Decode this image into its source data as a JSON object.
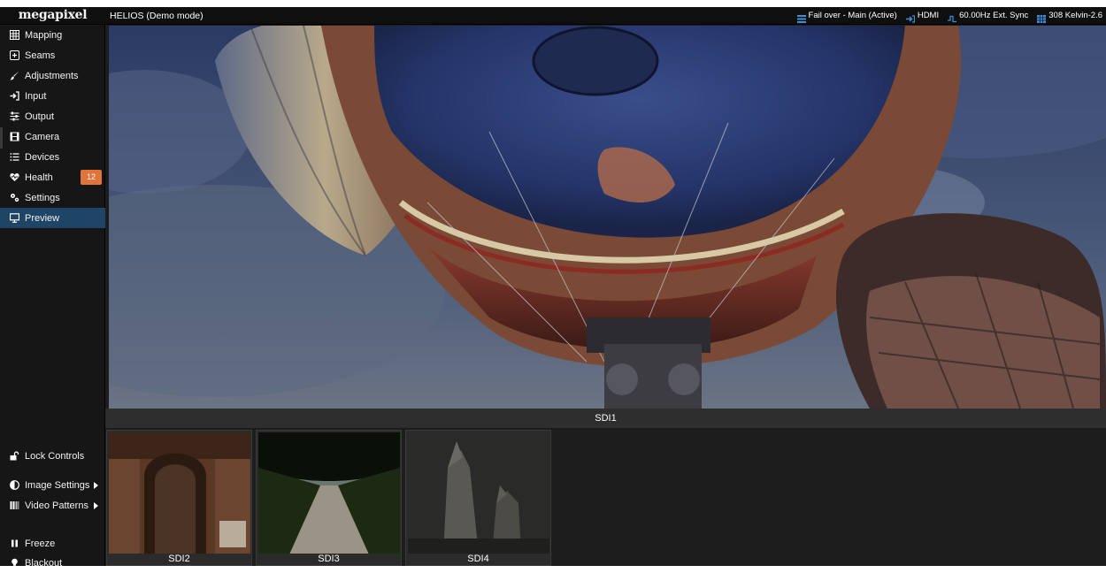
{
  "app": {
    "logo": "megapixel",
    "title": "HELIOS (Demo mode)"
  },
  "status": {
    "failover": "Fail over - Main (Active)",
    "input": "HDMI",
    "sync": "60.00Hz Ext. Sync",
    "kelvin": "308 Kelvin-2.6"
  },
  "sidebar": {
    "items": [
      {
        "label": "Mapping",
        "icon": "grid-icon"
      },
      {
        "label": "Seams",
        "icon": "plus-square-icon"
      },
      {
        "label": "Adjustments",
        "icon": "brush-icon"
      },
      {
        "label": "Input",
        "icon": "sign-in-icon"
      },
      {
        "label": "Output",
        "icon": "sliders-icon"
      },
      {
        "label": "Camera",
        "icon": "film-icon"
      },
      {
        "label": "Devices",
        "icon": "list-icon"
      },
      {
        "label": "Health",
        "icon": "heartbeat-icon",
        "badge": "12"
      },
      {
        "label": "Settings",
        "icon": "gears-icon"
      },
      {
        "label": "Preview",
        "icon": "monitor-icon",
        "active": true
      }
    ],
    "bottom": {
      "lock": "Lock Controls",
      "image_settings": "Image Settings",
      "video_patterns": "Video Patterns",
      "freeze": "Freeze",
      "blackout": "Blackout"
    }
  },
  "preview": {
    "main_label": "SDI1",
    "thumbs": [
      "SDI2",
      "SDI3",
      "SDI4"
    ]
  },
  "colors": {
    "active_nav": "#1f4566",
    "badge": "#e0743a",
    "status_icon": "#3f8fd8"
  }
}
